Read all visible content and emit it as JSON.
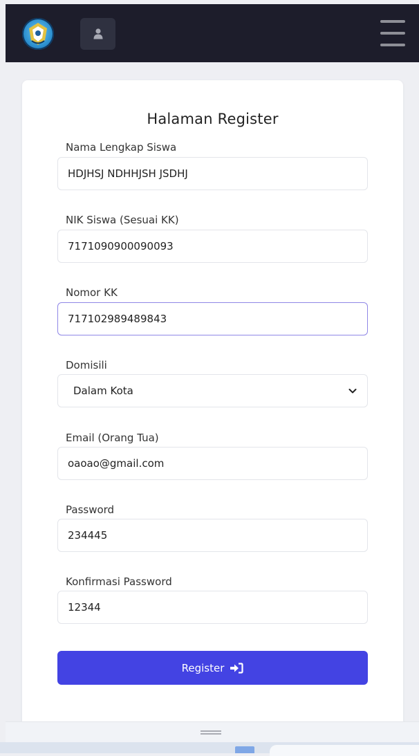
{
  "header": {
    "logo_icon": "tut-wuri-handayani-logo-icon",
    "user_icon": "user-icon",
    "menu_icon": "hamburger-menu-icon"
  },
  "form": {
    "title": "Halaman Register",
    "fields": [
      {
        "label": "Nama Lengkap Siswa",
        "value": "HDJHSJ NDHHJSH JSDHJ"
      },
      {
        "label": "NIK Siswa (Sesuai KK)",
        "value": "7171090900090093"
      },
      {
        "label": "Nomor KK",
        "value": "717102989489843"
      },
      {
        "label": "Domisili",
        "value": "Dalam Kota"
      },
      {
        "label": "Email (Orang Tua)",
        "value": "oaoao@gmail.com"
      },
      {
        "label": "Password",
        "value": "234445"
      },
      {
        "label": "Konfirmasi Password",
        "value": "12344"
      }
    ],
    "submit_label": "Register",
    "submit_icon": "sign-in-icon"
  },
  "colors": {
    "navbar": "#1d1d2b",
    "accent": "#4343e3",
    "focus_border": "#8f86e6"
  }
}
